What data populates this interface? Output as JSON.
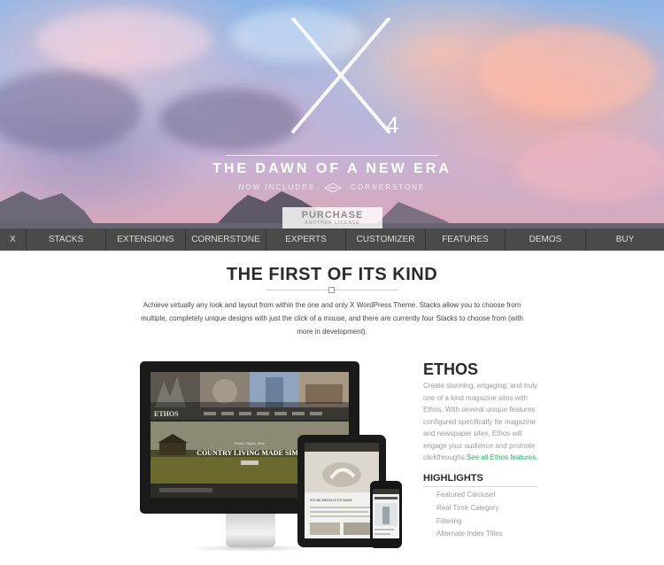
{
  "hero": {
    "logo_sup": "4",
    "tagline": "THE DAWN OF A NEW ERA",
    "subtag_left": "NOW INCLUDES",
    "subtag_right": "CORNERSTONE",
    "purchase_label": "PURCHASE",
    "purchase_sub": "ANOTHER LICENSE"
  },
  "nav": {
    "items": [
      "X",
      "STACKS",
      "EXTENSIONS",
      "CORNERSTONE",
      "EXPERTS",
      "CUSTOMIZER",
      "FEATURES",
      "DEMOS",
      "BUY"
    ]
  },
  "main": {
    "title": "THE FIRST OF ITS KIND",
    "intro": "Achieve virtually any look and layout from within the one and only X WordPress Theme. Stacks allow you to choose from multiple, completely unique designs with just the click of a mouse, and there are currently four Stacks to choose from (with more in development)."
  },
  "mockup": {
    "site_name": "ETHOS",
    "hero_kicker": "Rustic Sights, Alive",
    "hero_headline": "COUNTRY LIVING MADE SIMP",
    "tablet_caption": "SOCIAL MEDIA IN ITS WAKE"
  },
  "ethos": {
    "title": "ETHOS",
    "description": "Create stunning, engaging, and truly one of a kind magazine sites with Ethos. With several unique features configured specifically for magazine and newspaper sites, Ethos will engage your audience and promote clickthroughs.",
    "link": "See all Ethos features.",
    "highlights_title": "HIGHLIGHTS",
    "highlights": [
      "Featured Carousel",
      "Real Time Category",
      "Filtering",
      "Alternate Index Titles"
    ]
  },
  "colors": {
    "nav_bg": "#4a4a4a",
    "link_green": "#2fae5e"
  }
}
